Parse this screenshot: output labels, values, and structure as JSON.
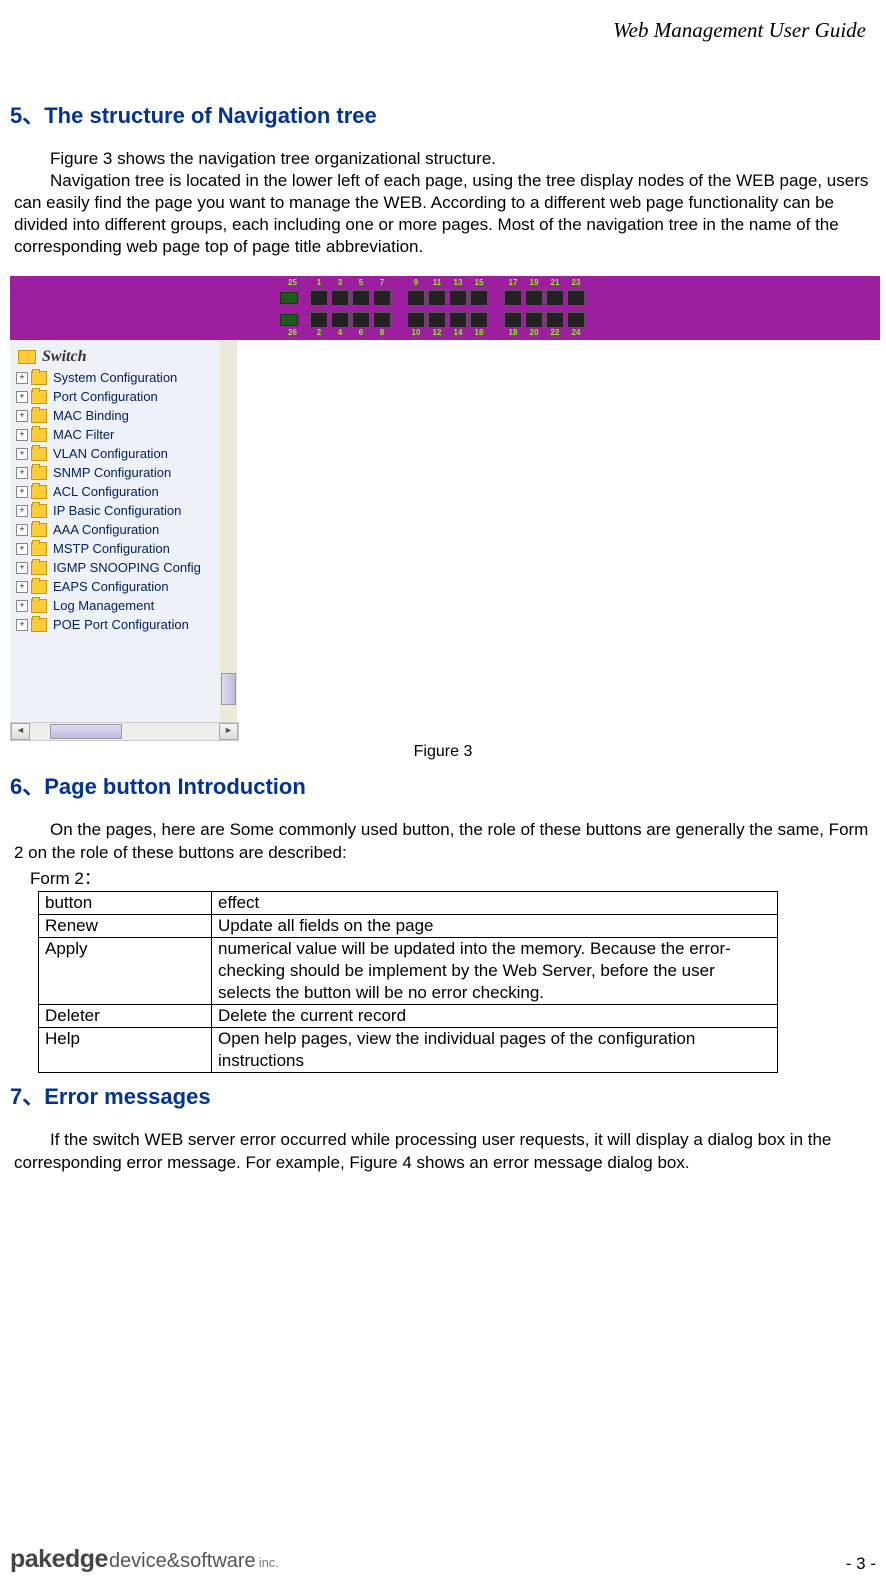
{
  "header": {
    "guide_title": "Web Management User Guide"
  },
  "section5": {
    "title": "5、The structure of Navigation tree",
    "p1": "Figure 3 shows the navigation tree organizational structure.",
    "p2": "Navigation tree is located in the lower left of each page, using the tree display nodes of the WEB page, users can easily find the page you want to manage the WEB. According to a different web page functionality can be divided into different groups, each including one or more pages. Most of the navigation tree in the name of the corresponding web page top of page title abbreviation."
  },
  "port_panel": {
    "left_top": "25",
    "left_bot": "26",
    "top_numbers": [
      "1",
      "3",
      "5",
      "7",
      "",
      "9",
      "11",
      "13",
      "15",
      "",
      "17",
      "19",
      "21",
      "23"
    ],
    "bot_numbers": [
      "2",
      "4",
      "6",
      "8",
      "",
      "10",
      "12",
      "14",
      "16",
      "",
      "18",
      "20",
      "22",
      "24"
    ]
  },
  "nav_tree": {
    "root": "Switch",
    "items": [
      "System Configuration",
      "Port Configuration",
      "MAC Binding",
      "MAC Filter",
      "VLAN Configuration",
      "SNMP Configuration",
      "ACL Configuration",
      "IP Basic Configuration",
      "AAA Configuration",
      "MSTP Configuration",
      "IGMP SNOOPING Config",
      "EAPS Configuration",
      "Log Management",
      "POE Port Configuration"
    ]
  },
  "figure3_caption": "Figure 3",
  "section6": {
    "title": "6、Page button Introduction",
    "p1": "On the pages, here are Some commonly used button, the role of these buttons are generally the same, Form 2 on the role of these buttons are described:",
    "form_label": "Form 2：",
    "table": {
      "headers": {
        "col1": "button",
        "col2": "effect"
      },
      "rows": [
        {
          "button": "Renew",
          "effect": "Update all fields on the page"
        },
        {
          "button": "Apply",
          "effect": "numerical value will be updated into the memory. Because the error-checking should be implement    by the Web Server, before the user selects the button will be no error checking."
        },
        {
          "button": "Deleter",
          "effect": "Delete the current record"
        },
        {
          "button": "Help",
          "effect": "Open help pages, view the individual pages of the configuration instructions"
        }
      ]
    }
  },
  "section7": {
    "title": "7、Error messages",
    "p1": "If the switch WEB server error occurred while processing user requests, it will display a dialog box in the corresponding error message. For example, Figure 4 shows an error message dialog box."
  },
  "footer": {
    "logo_bold": "pakedge",
    "logo_rest": "device&software",
    "logo_inc": "inc.",
    "page_num": "- 3 -"
  }
}
